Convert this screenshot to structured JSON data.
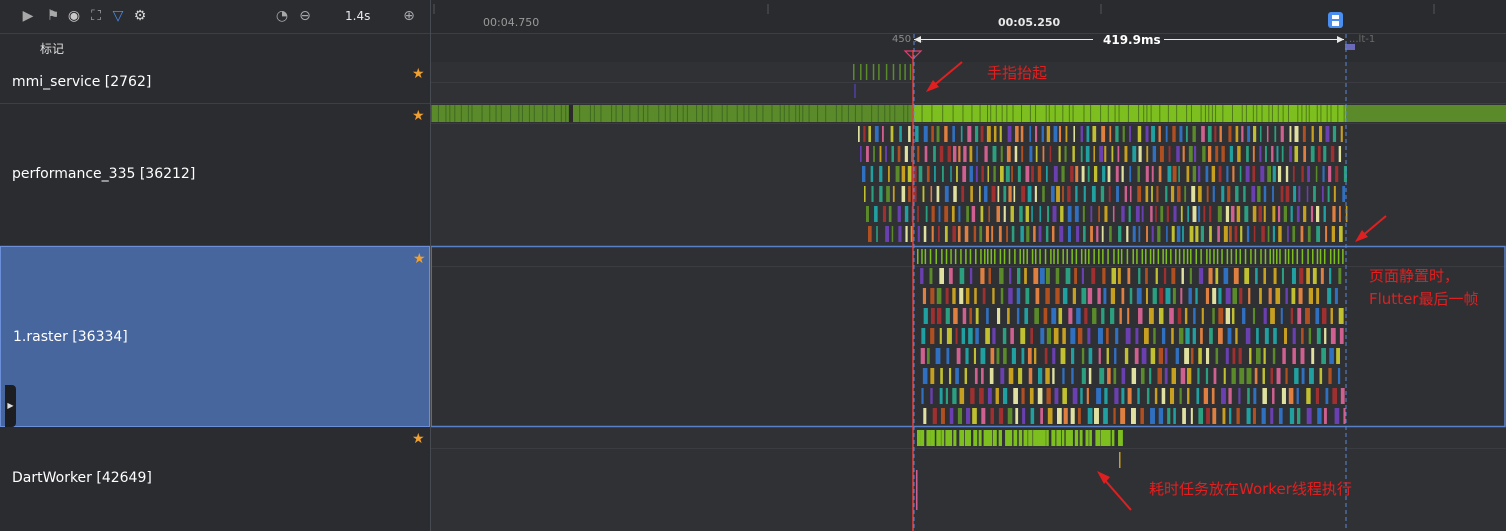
{
  "toolbar": {
    "zoom_label": "1.4s",
    "icons": [
      "play-icon",
      "flag-icon",
      "globe-icon",
      "capture-icon",
      "filter-icon",
      "settings-icon",
      "zoom-reset-icon",
      "zoom-out-icon",
      "zoom-in-icon"
    ]
  },
  "marks_label": "标记",
  "tracks": [
    {
      "name": "mmi_service [2762]"
    },
    {
      "name": "performance_335 [36212]"
    },
    {
      "name": "1.raster [36334]",
      "selected": true
    },
    {
      "name": "DartWorker [42649]"
    }
  ],
  "timeline": {
    "ticks": [
      "00:04.750",
      "00:05.250"
    ],
    "range_start_label": "450",
    "range_start_suffix": "...",
    "range_end_label": "...lt-1",
    "duration_label": "419.9ms"
  },
  "annotations": {
    "finger_up": "手指抬起",
    "page_static_line1": "页面静置时，",
    "page_static_line2": "Flutter最后一帧",
    "worker_note": "耗时任务放在Worker线程执行"
  },
  "colors": {
    "green": "#7dbf1e",
    "dark_green": "#5a8a2a",
    "annotation_red": "#e02020",
    "selection_blue": "#47669e",
    "cursor_red": "#e04040",
    "dash_blue": "#5a88d8"
  }
}
